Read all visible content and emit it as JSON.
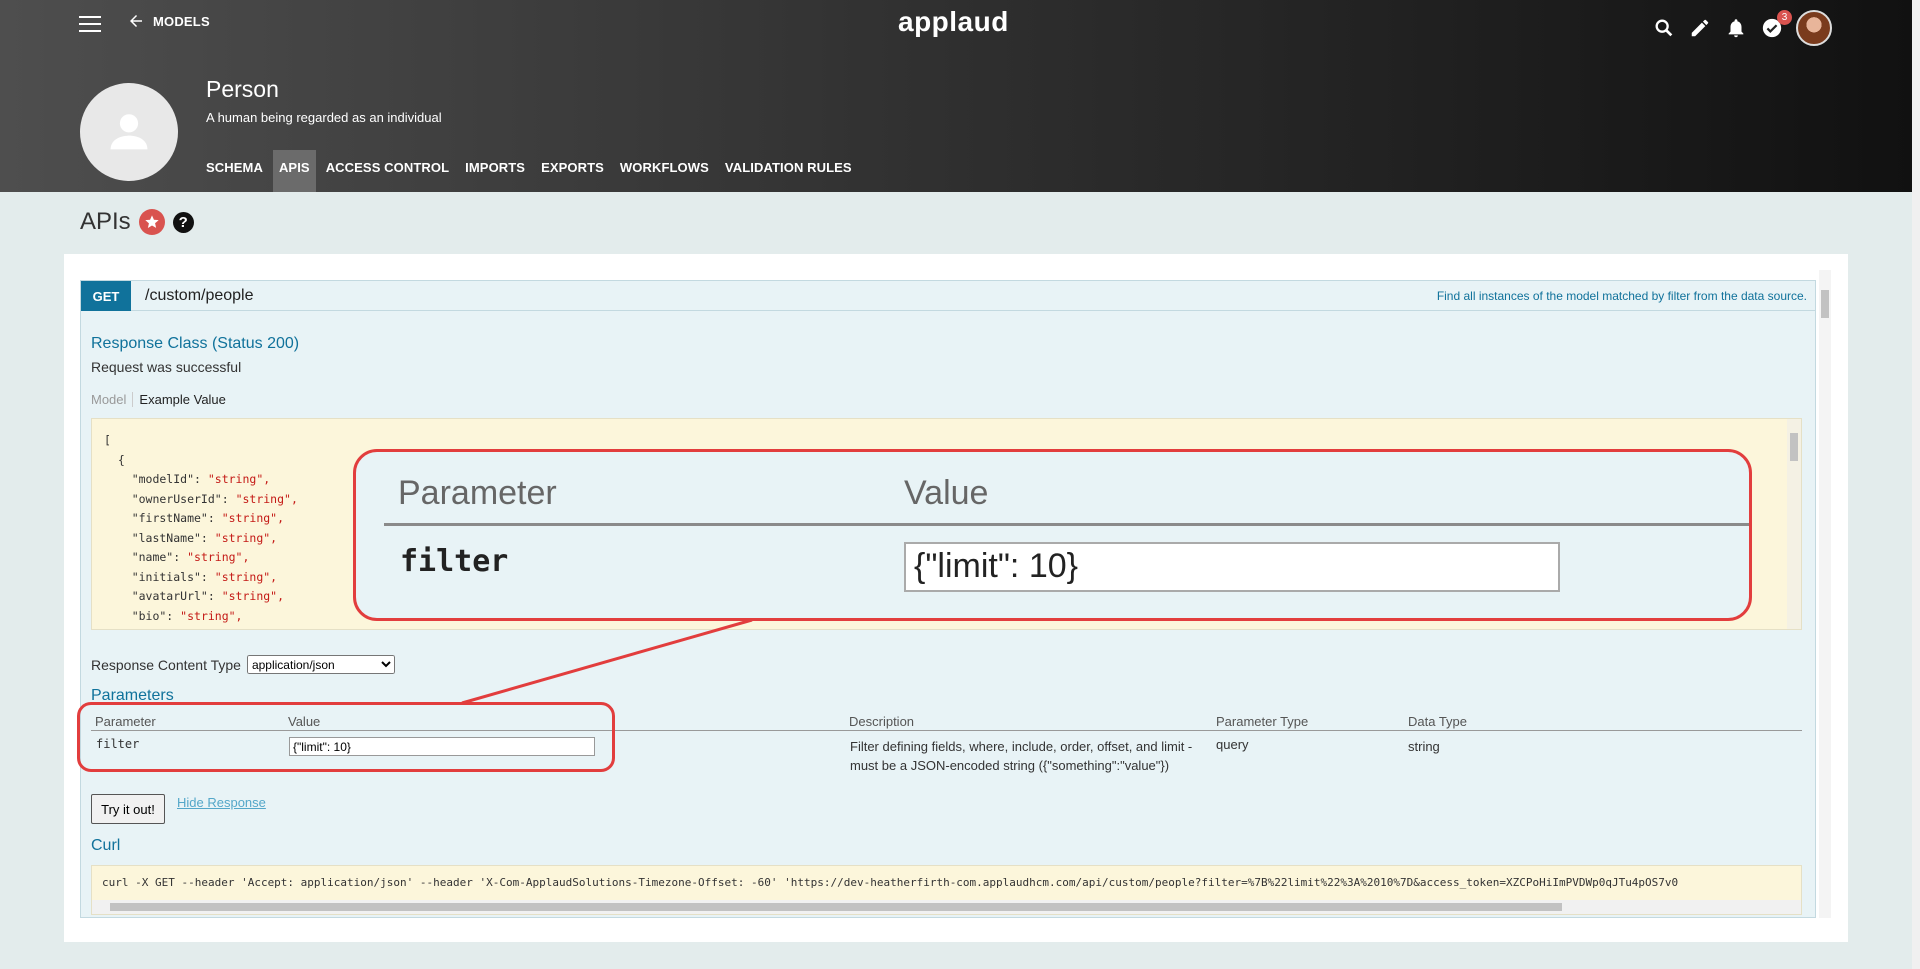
{
  "header": {
    "back_label": "MODELS",
    "logo": "applaud",
    "notification_count": "3",
    "icons": [
      "menu-icon",
      "arrow-left-icon",
      "search-icon",
      "pencil-icon",
      "bell-icon",
      "check-circle-icon",
      "user-avatar"
    ]
  },
  "model": {
    "title": "Person",
    "description": "A human being regarded as an individual",
    "tabs": [
      "SCHEMA",
      "APIS",
      "ACCESS CONTROL",
      "IMPORTS",
      "EXPORTS",
      "WORKFLOWS",
      "VALIDATION RULES"
    ],
    "active_tab": "APIS"
  },
  "page": {
    "title": "APIs",
    "help": "?"
  },
  "operation": {
    "method": "GET",
    "path": "/custom/people",
    "summary": "Find all instances of the model matched by filter from the data source.",
    "response_class": "Response Class (Status 200)",
    "response_note": "Request was successful",
    "model_tab": "Model",
    "example_tab": "Example Value",
    "example_lines": [
      {
        "t": "["
      },
      {
        "t": "  {"
      },
      {
        "k": "    \"modelId\": ",
        "v": "\"string\","
      },
      {
        "k": "    \"ownerUserId\": ",
        "v": "\"string\","
      },
      {
        "k": "    \"firstName\": ",
        "v": "\"string\","
      },
      {
        "k": "    \"lastName\": ",
        "v": "\"string\","
      },
      {
        "k": "    \"name\": ",
        "v": "\"string\","
      },
      {
        "k": "    \"initials\": ",
        "v": "\"string\","
      },
      {
        "k": "    \"avatarUrl\": ",
        "v": "\"string\","
      },
      {
        "k": "    \"bio\": ",
        "v": "\"string\","
      }
    ],
    "content_type_label": "Response Content Type",
    "content_type_value": "application/json",
    "parameters_title": "Parameters",
    "param_headers": [
      "Parameter",
      "Value",
      "Description",
      "Parameter Type",
      "Data Type"
    ],
    "param": {
      "name": "filter",
      "value": "{\"limit\": 10}",
      "description": "Filter defining fields, where, include, order, offset, and limit - must be a JSON-encoded string ({\"something\":\"value\"})",
      "type": "query",
      "data_type": "string"
    },
    "try_label": "Try it out!",
    "hide_label": "Hide Response",
    "curl_title": "Curl",
    "curl": "curl -X GET --header 'Accept: application/json' --header 'X-Com-ApplaudSolutions-Timezone-Offset: -60' 'https://dev-heatherfirth-com.applaudhcm.com/api/custom/people?filter=%7B%22limit%22%3A%2010%7D&access_token=XZCPoHiImPVDWp0qJTu4pOS7v0"
  },
  "callout": {
    "param_header": "Parameter",
    "value_header": "Value",
    "param_name": "filter",
    "param_value": "{\"limit\": 10}"
  },
  "colors": {
    "header_dark": "#111111",
    "method_bg": "#10729b",
    "annotation": "#e23d3d",
    "code_bg": "#fcf6db"
  }
}
